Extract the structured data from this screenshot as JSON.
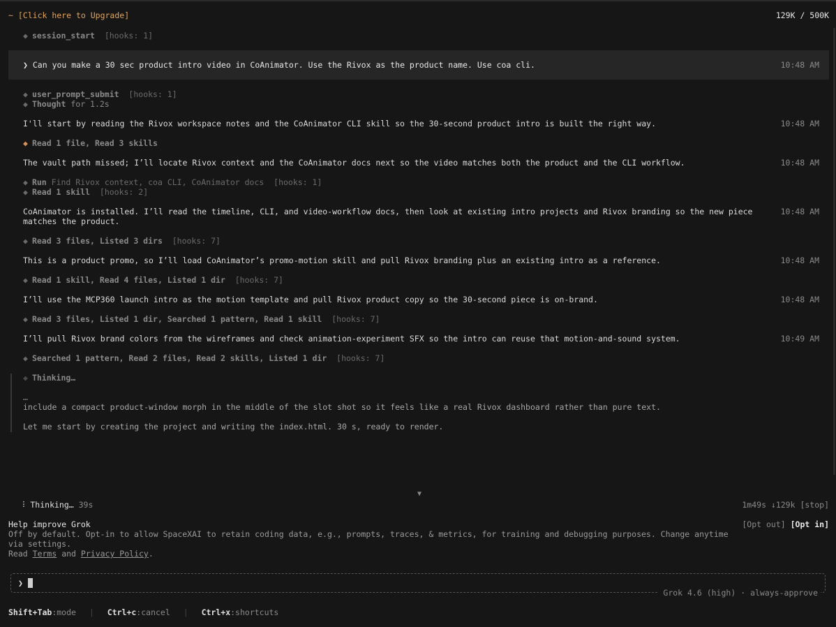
{
  "header": {
    "upgrade_prefix": "~",
    "upgrade_link": "[Click here to Upgrade]",
    "tokens": "129K / 500K"
  },
  "events": {
    "session_start": {
      "name": "session_start",
      "hooks": "[hooks: 1]"
    },
    "user_prompt": {
      "caret": "❯",
      "text": "Can you make a 30 sec product intro video in CoAnimator. Use the Rivox  as the product name. Use coa cli.",
      "time": "10:48 AM"
    },
    "prompt_submit": {
      "name": "user_prompt_submit",
      "hooks": "[hooks: 1]"
    },
    "thought": {
      "label": "Thought",
      "detail": "for 1.2s"
    },
    "msg1": {
      "text": "I'll start by reading the Rivox workspace notes and the CoAnimator CLI skill so the 30-second product intro is built the right way.",
      "time": "10:48 AM"
    },
    "tool1": {
      "label": "Read 1 file, Read 3 skills"
    },
    "msg2": {
      "text": "The vault path missed; I’ll locate Rivox context and the CoAnimator docs next so the video matches both the product and the CLI workflow.",
      "time": "10:48 AM"
    },
    "tool2": {
      "label": "Run",
      "detail": "Find Rivox context, coa CLI, CoAnimator docs",
      "hooks": "[hooks: 1]"
    },
    "tool3": {
      "label": "Read 1 skill",
      "hooks": "[hooks: 2]"
    },
    "msg3": {
      "line1": "CoAnimator is installed. I’ll read the timeline, CLI, and video-workflow docs, then look at existing intro projects and Rivox branding so the new piece",
      "line2": "matches the product.",
      "time": "10:48 AM"
    },
    "tool4": {
      "label": "Read 3 files, Listed 3 dirs",
      "hooks": "[hooks: 7]"
    },
    "msg4": {
      "text": "This is a product promo, so I’ll load CoAnimator’s promo-motion skill and pull Rivox branding plus an existing intro as a reference.",
      "time": "10:48 AM"
    },
    "tool5": {
      "label": "Read 1 skill, Read 4 files, Listed 1 dir",
      "hooks": "[hooks: 7]"
    },
    "msg5": {
      "text": "I’ll use the MCP360 launch intro as the motion template and pull Rivox product copy so the 30-second piece is on-brand.",
      "time": "10:48 AM"
    },
    "tool6": {
      "label": "Read 3 files, Listed 1 dir, Searched 1 pattern, Read 1 skill",
      "hooks": "[hooks: 7]"
    },
    "msg6": {
      "text": "I’ll pull Rivox brand colors from the wireframes and check animation-experiment SFX so the intro can reuse that motion-and-sound system.",
      "time": "10:49 AM"
    },
    "tool7": {
      "label": "Searched 1 pattern, Read 2 files, Read 2 skills, Listed 1 dir",
      "hooks": "[hooks: 7]"
    },
    "thinking": {
      "label": "Thinking…",
      "ellipsis": "…",
      "line1": "include a compact product-window morph in the middle of the slot shot so it feels like a real Rivox dashboard rather than pure text.",
      "line2": "Let me start by creating the project and writing the index.html. 30 s, ready to render."
    }
  },
  "scroll_arrow": "▼",
  "status": {
    "spinner": "⠸",
    "label": "Thinking…",
    "elapsed": "39s",
    "right": "1m49s ↓129k [stop]"
  },
  "improve": {
    "title": "Help improve Grok",
    "body": "Off by default. Opt-in to allow SpaceXAI to retain coding data, e.g., prompts, traces, & metrics, for training and debugging purposes. Change anytime via settings.",
    "read_prefix": "Read",
    "terms": "Terms",
    "and": "and",
    "privacy": "Privacy Policy",
    "period": ".",
    "opt_out": "[Opt out]",
    "opt_in": "[Opt in]"
  },
  "input": {
    "caret": "❯",
    "value": ""
  },
  "model": {
    "name": "Grok 4.6 (high)",
    "sep": "·",
    "mode": "always-approve"
  },
  "footer": {
    "items": [
      {
        "key": "Shift+Tab",
        "action": ":mode"
      },
      {
        "key": "Ctrl+c",
        "action": ":cancel"
      },
      {
        "key": "Ctrl+x",
        "action": ":shortcuts"
      }
    ],
    "sep": "|"
  },
  "colors": {
    "background": "#161616",
    "accent_orange": "#e0a45e",
    "prompt_bg": "#262626"
  }
}
